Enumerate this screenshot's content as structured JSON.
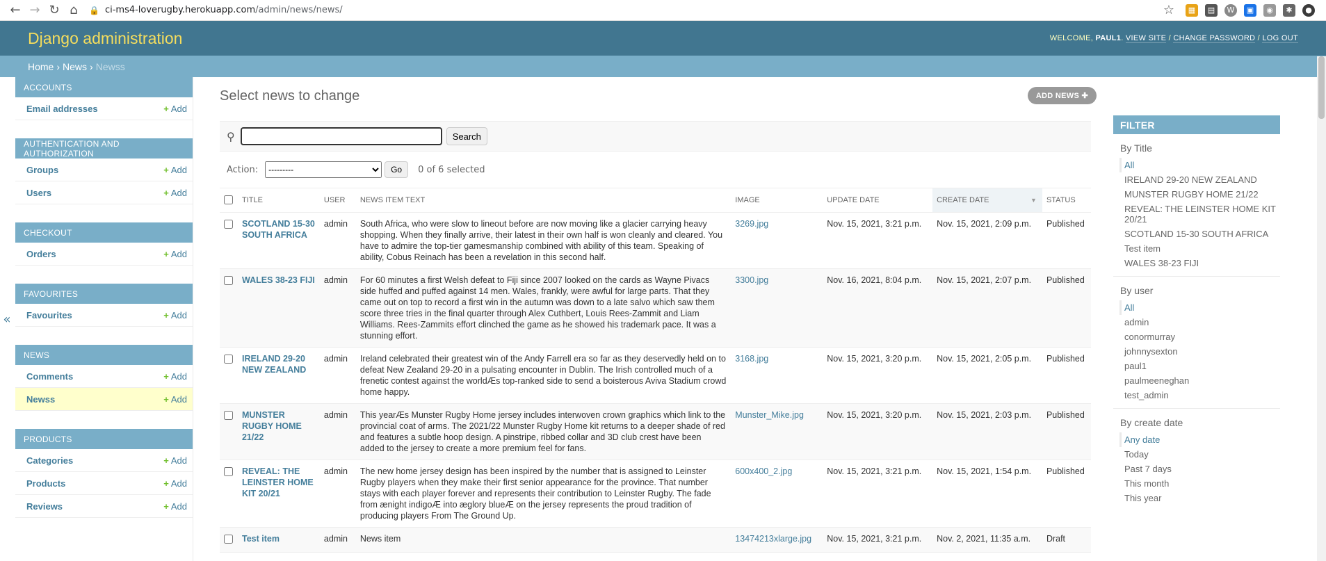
{
  "browser": {
    "url_host": "ci-ms4-loverugby.herokuapp.com",
    "url_path": "/admin/news/news/"
  },
  "header": {
    "brand": "Django administration",
    "welcome": "WELCOME,",
    "username": "PAUL1",
    "view_site": "VIEW SITE",
    "change_password": "CHANGE PASSWORD",
    "log_out": "LOG OUT"
  },
  "breadcrumbs": {
    "home": "Home",
    "app": "News",
    "current": "Newss"
  },
  "sidebar": {
    "add_label": "Add",
    "toggle": "«",
    "modules": [
      {
        "caption": "ACCOUNTS",
        "items": [
          {
            "label": "Email addresses"
          }
        ]
      },
      {
        "caption": "AUTHENTICATION AND AUTHORIZATION",
        "items": [
          {
            "label": "Groups"
          },
          {
            "label": "Users"
          }
        ]
      },
      {
        "caption": "CHECKOUT",
        "items": [
          {
            "label": "Orders"
          }
        ]
      },
      {
        "caption": "FAVOURITES",
        "items": [
          {
            "label": "Favourites"
          }
        ]
      },
      {
        "caption": "NEWS",
        "items": [
          {
            "label": "Comments"
          },
          {
            "label": "Newss"
          }
        ]
      },
      {
        "caption": "PRODUCTS",
        "items": [
          {
            "label": "Categories"
          },
          {
            "label": "Products"
          },
          {
            "label": "Reviews"
          }
        ]
      }
    ]
  },
  "content": {
    "title": "Select news to change",
    "add_button": "ADD NEWS",
    "search_button": "Search",
    "action_label": "Action:",
    "action_selected": "---------",
    "go_button": "Go",
    "selected_count": "0 of 6 selected"
  },
  "table": {
    "headers": {
      "title": "TITLE",
      "user": "USER",
      "text": "NEWS ITEM TEXT",
      "image": "IMAGE",
      "update_date": "UPDATE DATE",
      "create_date": "CREATE DATE",
      "status": "STATUS"
    },
    "rows": [
      {
        "title": "SCOTLAND 15-30 SOUTH AFRICA",
        "user": "admin",
        "text": "South Africa, who were slow to lineout before are now moving like a glacier carrying heavy shopping. When they finally arrive, their latest in their own half is won cleanly and cleared. You have to admire the top-tier gamesmanship combined with ability of this team. Speaking of ability, Cobus Reinach has been a revelation in this second half.",
        "image": "3269.jpg",
        "update": "Nov. 15, 2021, 3:21 p.m.",
        "create": "Nov. 15, 2021, 2:09 p.m.",
        "status": "Published"
      },
      {
        "title": "WALES 38-23 FIJI",
        "user": "admin",
        "text": "For 60 minutes a first Welsh defeat to Fiji since 2007 looked on the cards as Wayne Pivacs side huffed and puffed against 14 men. Wales, frankly, were awful for large parts. That they came out on top to record a first win in the autumn was down to a late salvo which saw them score three tries in the final quarter through Alex Cuthbert, Louis Rees-Zammit and Liam Williams. Rees-Zammits effort clinched the game as he showed his trademark pace. It was a stunning effort.",
        "image": "3300.jpg",
        "update": "Nov. 16, 2021, 8:04 p.m.",
        "create": "Nov. 15, 2021, 2:07 p.m.",
        "status": "Published"
      },
      {
        "title": "IRELAND 29-20 NEW ZEALAND",
        "user": "admin",
        "text": "Ireland celebrated their greatest win of the Andy Farrell era so far as they deservedly held on to defeat New Zealand 29-20 in a pulsating encounter in Dublin. The Irish controlled much of a frenetic contest against the worldÆs top-ranked side to send a boisterous Aviva Stadium crowd home happy.",
        "image": "3168.jpg",
        "update": "Nov. 15, 2021, 3:20 p.m.",
        "create": "Nov. 15, 2021, 2:05 p.m.",
        "status": "Published"
      },
      {
        "title": "MUNSTER RUGBY HOME 21/22",
        "user": "admin",
        "text": "This yearÆs Munster Rugby Home jersey includes interwoven crown graphics which link to the provincial coat of arms. The 2021/22 Munster Rugby Home kit returns to a deeper shade of red and features a subtle hoop design. A pinstripe, ribbed collar and 3D club crest have been added to the jersey to create a more premium feel for fans.",
        "image": "Munster_Mike.jpg",
        "update": "Nov. 15, 2021, 3:20 p.m.",
        "create": "Nov. 15, 2021, 2:03 p.m.",
        "status": "Published"
      },
      {
        "title": "REVEAL: THE LEINSTER HOME KIT 20/21",
        "user": "admin",
        "text": "The new home jersey design has been inspired by the number that is assigned to Leinster Rugby players when they make their first senior appearance for the province. That number stays with each player forever and represents their contribution to Leinster Rugby. The fade from ænight indigoÆ into æglory blueÆ on the jersey represents the proud tradition of producing players From The Ground Up.",
        "image": "600x400_2.jpg",
        "update": "Nov. 15, 2021, 3:21 p.m.",
        "create": "Nov. 15, 2021, 1:54 p.m.",
        "status": "Published"
      },
      {
        "title": "Test item",
        "user": "admin",
        "text": "News item",
        "image": "13474213xlarge.jpg",
        "update": "Nov. 15, 2021, 3:21 p.m.",
        "create": "Nov. 2, 2021, 11:35 a.m.",
        "status": "Draft"
      }
    ]
  },
  "filter": {
    "caption": "FILTER",
    "groups": [
      {
        "heading": "By Title",
        "options": [
          "All",
          "IRELAND 29-20 NEW ZEALAND",
          "MUNSTER RUGBY HOME 21/22",
          "REVEAL: THE LEINSTER HOME KIT 20/21",
          "SCOTLAND 15-30 SOUTH AFRICA",
          "Test item",
          "WALES 38-23 FIJI"
        ]
      },
      {
        "heading": "By user",
        "options": [
          "All",
          "admin",
          "conormurray",
          "johnnysexton",
          "paul1",
          "paulmeeneghan",
          "test_admin"
        ]
      },
      {
        "heading": "By create date",
        "options": [
          "Any date",
          "Today",
          "Past 7 days",
          "This month",
          "This year"
        ]
      }
    ]
  },
  "colors": {
    "header_bg": "#417690",
    "brand": "#f5dd5d",
    "breadcrumb_bg": "#79aec8",
    "link": "#447e9b",
    "add_plus": "#70bf2b"
  }
}
